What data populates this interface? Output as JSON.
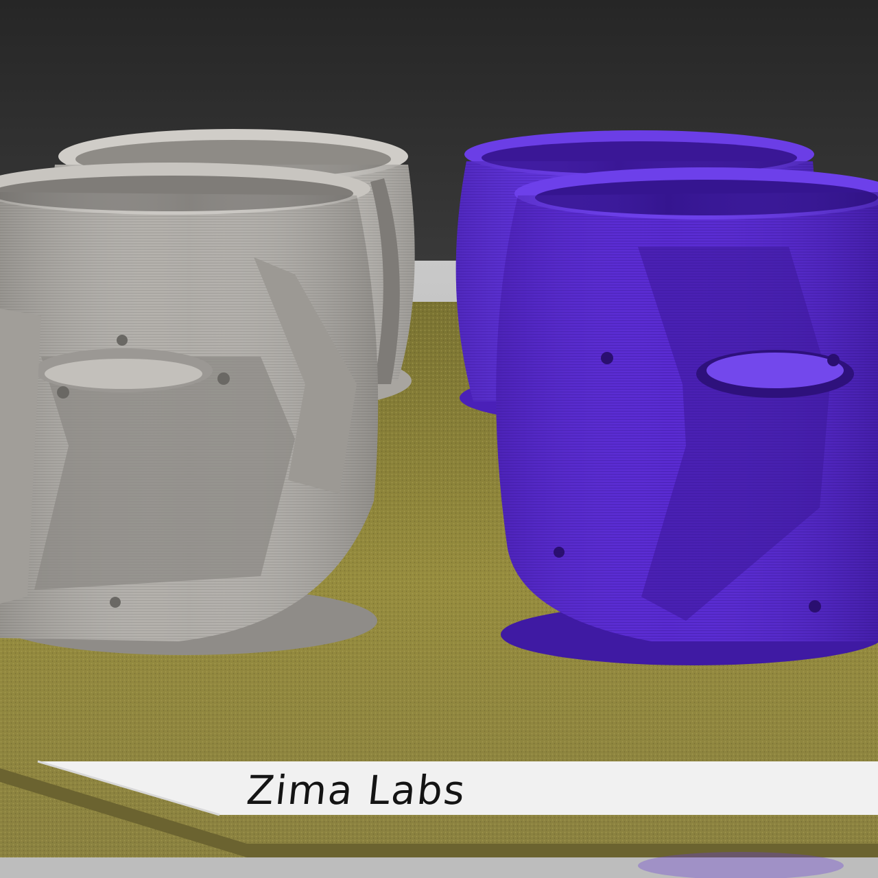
{
  "label": {
    "text": "Zima Labs"
  },
  "objects": [
    {
      "name": "gray-print-back",
      "color": "#b9b6b1"
    },
    {
      "name": "gray-print-front",
      "color": "#a9a6a1"
    },
    {
      "name": "purple-print-back",
      "color": "#5b2fd6"
    },
    {
      "name": "purple-print-front",
      "color": "#5a2bd4"
    }
  ],
  "colors": {
    "background": "#343434",
    "build_plate": "#8c8338",
    "plate_label": "#f2f2f2",
    "label_text": "#141414"
  }
}
